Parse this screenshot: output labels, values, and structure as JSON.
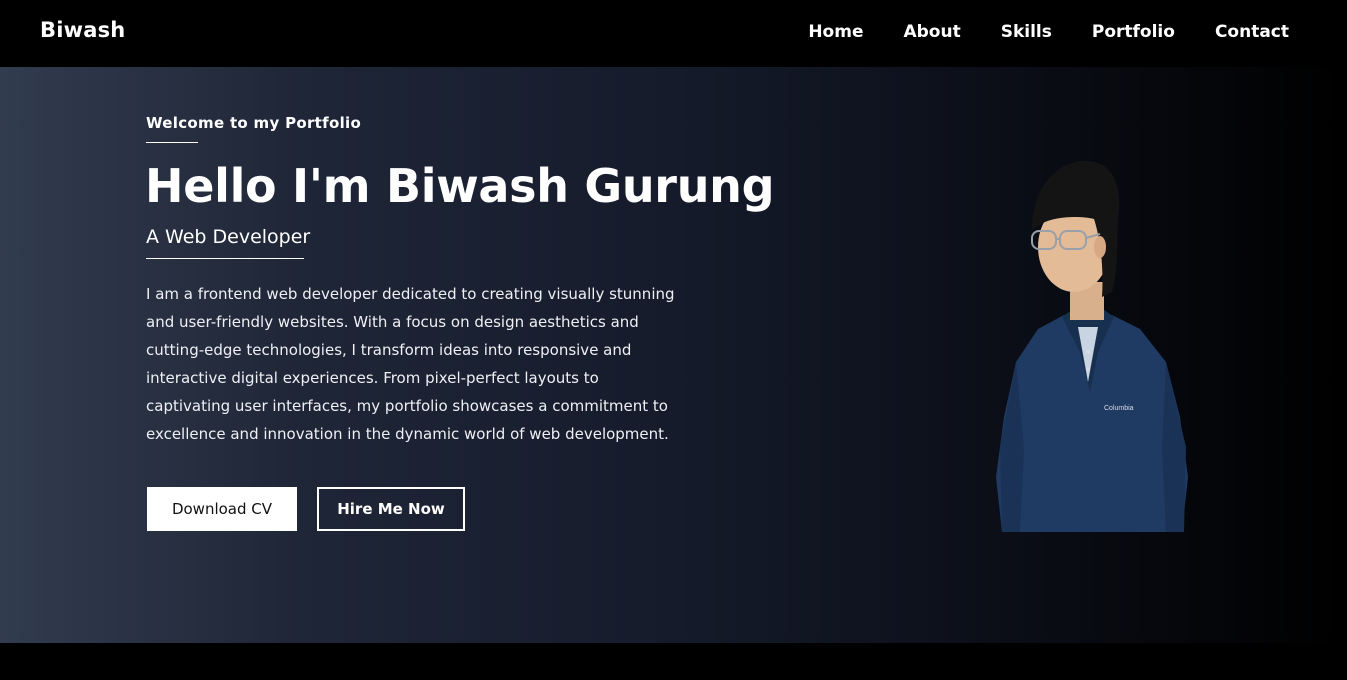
{
  "nav": {
    "brand": "Biwash",
    "links": [
      "Home",
      "About",
      "Skills",
      "Portfolio",
      "Contact"
    ]
  },
  "hero": {
    "welcome": "Welcome to my Portfolio",
    "headline": "Hello I'm Biwash Gurung",
    "role": "A Web Developer",
    "bio": "I am a frontend web developer dedicated to creating visually stunning and user-friendly websites. With a focus on design aesthetics and cutting-edge technologies, I transform ideas into responsive and interactive digital experiences. From pixel-perfect layouts to captivating user interfaces, my portfolio showcases a commitment to excellence and innovation in the dynamic world of web development.",
    "buttons": {
      "download": "Download CV",
      "hire": "Hire Me Now"
    },
    "portrait_logo": "Columbia"
  },
  "colors": {
    "navbar_bg": "#000000",
    "gradient_start": "#323c4f",
    "gradient_end": "#000000",
    "text": "#ffffff",
    "shirt": "#1f3a63"
  }
}
